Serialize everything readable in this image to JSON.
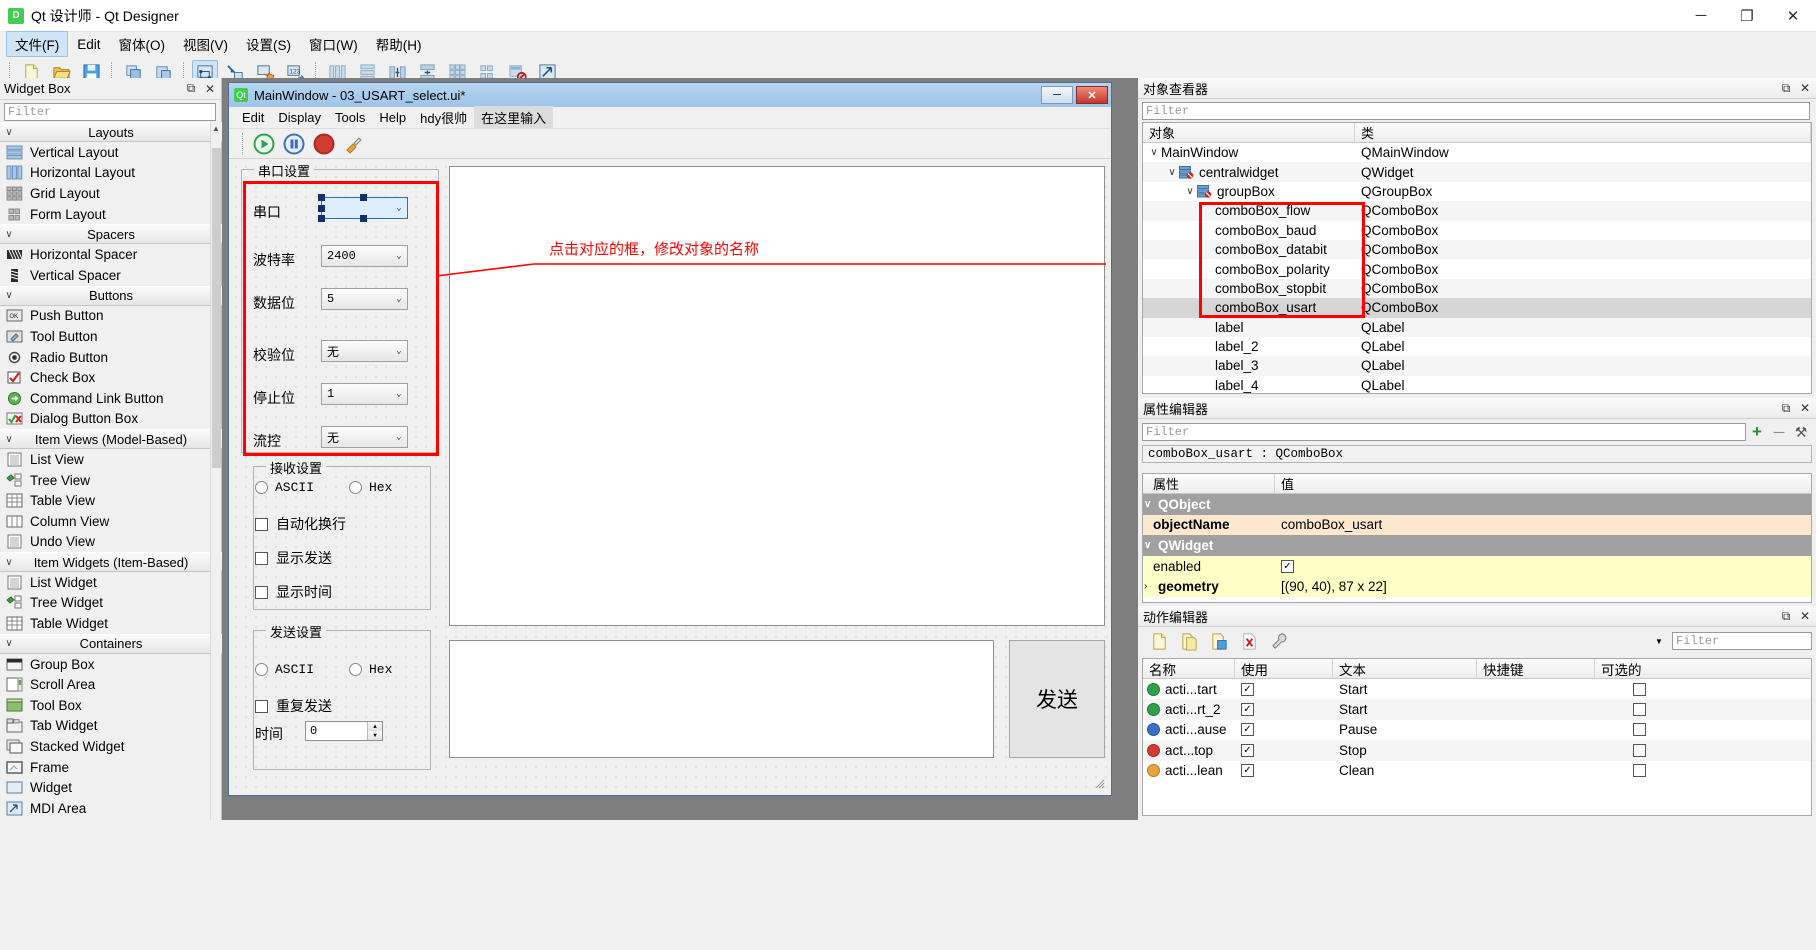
{
  "window": {
    "title": "Qt 设计师 - Qt Designer",
    "logo_text": "D",
    "minimize": "─",
    "maximize": "❐",
    "close": "✕"
  },
  "menubar": [
    {
      "label": "文件(F)",
      "active": true
    },
    {
      "label": "Edit",
      "active": false
    },
    {
      "label": "窗体(O)",
      "active": false
    },
    {
      "label": "视图(V)",
      "active": false
    },
    {
      "label": "设置(S)",
      "active": false
    },
    {
      "label": "窗口(W)",
      "active": false
    },
    {
      "label": "帮助(H)",
      "active": false
    }
  ],
  "toolbar": {
    "groups": [
      [
        "new-file-icon",
        "open-folder-icon",
        "save-icon"
      ],
      [
        "copy-icon",
        "paste-icon"
      ],
      [
        "edit-widgets-icon",
        "edit-signals-icon",
        "edit-buddies-icon",
        "edit-tab-order-icon"
      ],
      [
        "layout-horizontal-icon",
        "layout-vertical-icon",
        "layout-splitter-h-icon",
        "layout-splitter-v-icon",
        "layout-grid-icon",
        "layout-form-icon",
        "break-layout-icon",
        "adjust-size-icon"
      ]
    ]
  },
  "widget_box": {
    "title": "Widget Box",
    "filter_placeholder": "Filter",
    "float_btn": "⧉",
    "close_btn": "✕",
    "categories": [
      {
        "label": "Layouts",
        "items": [
          {
            "label": "Vertical Layout",
            "icon": "vertical-layout-icon"
          },
          {
            "label": "Horizontal Layout",
            "icon": "horizontal-layout-icon"
          },
          {
            "label": "Grid Layout",
            "icon": "grid-layout-icon"
          },
          {
            "label": "Form Layout",
            "icon": "form-layout-icon"
          }
        ]
      },
      {
        "label": "Spacers",
        "items": [
          {
            "label": "Horizontal Spacer",
            "icon": "horizontal-spacer-icon"
          },
          {
            "label": "Vertical Spacer",
            "icon": "vertical-spacer-icon"
          }
        ]
      },
      {
        "label": "Buttons",
        "items": [
          {
            "label": "Push Button",
            "icon": "push-button-icon"
          },
          {
            "label": "Tool Button",
            "icon": "tool-button-icon"
          },
          {
            "label": "Radio Button",
            "icon": "radio-button-icon"
          },
          {
            "label": "Check Box",
            "icon": "check-box-icon"
          },
          {
            "label": "Command Link Button",
            "icon": "command-link-icon"
          },
          {
            "label": "Dialog Button Box",
            "icon": "dialog-button-box-icon"
          }
        ]
      },
      {
        "label": "Item Views (Model-Based)",
        "items": [
          {
            "label": "List View",
            "icon": "list-view-icon"
          },
          {
            "label": "Tree View",
            "icon": "tree-view-icon"
          },
          {
            "label": "Table View",
            "icon": "table-view-icon"
          },
          {
            "label": "Column View",
            "icon": "column-view-icon"
          },
          {
            "label": "Undo View",
            "icon": "undo-view-icon"
          }
        ]
      },
      {
        "label": "Item Widgets (Item-Based)",
        "items": [
          {
            "label": "List Widget",
            "icon": "list-widget-icon"
          },
          {
            "label": "Tree Widget",
            "icon": "tree-widget-icon"
          },
          {
            "label": "Table Widget",
            "icon": "table-widget-icon"
          }
        ]
      },
      {
        "label": "Containers",
        "items": [
          {
            "label": "Group Box",
            "icon": "group-box-icon"
          },
          {
            "label": "Scroll Area",
            "icon": "scroll-area-icon"
          },
          {
            "label": "Tool Box",
            "icon": "tool-box-icon"
          },
          {
            "label": "Tab Widget",
            "icon": "tab-widget-icon"
          },
          {
            "label": "Stacked Widget",
            "icon": "stacked-widget-icon"
          },
          {
            "label": "Frame",
            "icon": "frame-icon"
          },
          {
            "label": "Widget",
            "icon": "widget-icon"
          },
          {
            "label": "MDI Area",
            "icon": "mdi-area-icon"
          }
        ]
      }
    ]
  },
  "form": {
    "title": "MainWindow - 03_USART_select.ui*",
    "logo_text": "Qt",
    "min_btn": "─",
    "close_btn": "✕",
    "menus": [
      {
        "label": "Edit",
        "hint": false
      },
      {
        "label": "Display",
        "hint": false
      },
      {
        "label": "Tools",
        "hint": false
      },
      {
        "label": "Help",
        "hint": false
      },
      {
        "label": "hdy很帅",
        "hint": false
      },
      {
        "label": "在这里输入",
        "hint": true
      }
    ],
    "toolbar_icons": [
      "start-icon",
      "pause-icon",
      "stop-icon",
      "clean-icon"
    ],
    "serial_group": {
      "title": "串口设置",
      "rows": [
        {
          "label": "串口",
          "value": "",
          "selected": true
        },
        {
          "label": "波特率",
          "value": "2400",
          "selected": false
        },
        {
          "label": "数据位",
          "value": "5",
          "selected": false
        },
        {
          "label": "校验位",
          "value": "无",
          "selected": false
        },
        {
          "label": "停止位",
          "value": "1",
          "selected": false
        },
        {
          "label": "流控",
          "value": "无",
          "selected": false
        }
      ]
    },
    "receive_group": {
      "title": "接收设置",
      "radios": [
        {
          "label": "ASCII"
        },
        {
          "label": "Hex"
        }
      ],
      "checkboxes": [
        {
          "label": "自动化换行"
        },
        {
          "label": "显示发送"
        },
        {
          "label": "显示时间"
        }
      ]
    },
    "send_group": {
      "title": "发送设置",
      "radios": [
        {
          "label": "ASCII"
        },
        {
          "label": "Hex"
        }
      ],
      "checkbox": "重复发送",
      "time_label": "时间",
      "time_value": "0"
    },
    "send_button": "发送",
    "annotation": "点击对应的框，修改对象的名称"
  },
  "object_inspector": {
    "title": "对象查看器",
    "float_btn": "⧉",
    "close_btn": "✕",
    "filter_placeholder": "Filter",
    "columns": [
      "对象",
      "类"
    ],
    "rows": [
      {
        "name": "MainWindow",
        "class": "QMainWindow",
        "indent": 0,
        "expander": "∨",
        "icon": "",
        "highlighted": false,
        "alt": false
      },
      {
        "name": "centralwidget",
        "class": "QWidget",
        "indent": 1,
        "expander": "∨",
        "icon": "layout-icon",
        "highlighted": false,
        "alt": true
      },
      {
        "name": "groupBox",
        "class": "QGroupBox",
        "indent": 2,
        "expander": "∨",
        "icon": "layout-icon",
        "highlighted": false,
        "alt": false
      },
      {
        "name": "comboBox_flow",
        "class": "QComboBox",
        "indent": 3,
        "expander": "",
        "icon": "",
        "highlighted": false,
        "alt": true
      },
      {
        "name": "comboBox_baud",
        "class": "QComboBox",
        "indent": 3,
        "expander": "",
        "icon": "",
        "highlighted": false,
        "alt": false
      },
      {
        "name": "comboBox_databit",
        "class": "QComboBox",
        "indent": 3,
        "expander": "",
        "icon": "",
        "highlighted": false,
        "alt": true
      },
      {
        "name": "comboBox_polarity",
        "class": "QComboBox",
        "indent": 3,
        "expander": "",
        "icon": "",
        "highlighted": false,
        "alt": false
      },
      {
        "name": "comboBox_stopbit",
        "class": "QComboBox",
        "indent": 3,
        "expander": "",
        "icon": "",
        "highlighted": false,
        "alt": true
      },
      {
        "name": "comboBox_usart",
        "class": "QComboBox",
        "indent": 3,
        "expander": "",
        "icon": "",
        "highlighted": true,
        "alt": false
      },
      {
        "name": "label",
        "class": "QLabel",
        "indent": 3,
        "expander": "",
        "icon": "",
        "highlighted": false,
        "alt": true
      },
      {
        "name": "label_2",
        "class": "QLabel",
        "indent": 3,
        "expander": "",
        "icon": "",
        "highlighted": false,
        "alt": false
      },
      {
        "name": "label_3",
        "class": "QLabel",
        "indent": 3,
        "expander": "",
        "icon": "",
        "highlighted": false,
        "alt": true
      },
      {
        "name": "label_4",
        "class": "QLabel",
        "indent": 3,
        "expander": "",
        "icon": "",
        "highlighted": false,
        "alt": false
      }
    ]
  },
  "property_editor": {
    "title": "属性编辑器",
    "float_btn": "⧉",
    "close_btn": "✕",
    "filter_placeholder": "Filter",
    "add_btn": "+",
    "remove_btn": "─",
    "config_btn": "⚒",
    "object_header": "comboBox_usart : QComboBox",
    "columns": [
      "属性",
      "值"
    ],
    "rows": [
      {
        "name": "QObject",
        "value": "",
        "type": "group",
        "expander": "∨"
      },
      {
        "name": "objectName",
        "value": "comboBox_usart",
        "type": "peach",
        "expander": ""
      },
      {
        "name": "QWidget",
        "value": "",
        "type": "group",
        "expander": "∨"
      },
      {
        "name": "enabled",
        "value": "",
        "type": "yellow-check",
        "expander": ""
      },
      {
        "name": "geometry",
        "value": "[(90, 40), 87 x 22]",
        "type": "yellow-bold",
        "expander": "›"
      }
    ]
  },
  "action_editor": {
    "title": "动作编辑器",
    "float_btn": "⧉",
    "close_btn": "✕",
    "filter_placeholder": "Filter",
    "toolbar_icons": [
      "new-action-icon",
      "copy-action-icon",
      "paste-action-icon",
      "delete-action-icon",
      "configure-icon"
    ],
    "columns": [
      "名称",
      "使用",
      "文本",
      "快捷键",
      "可选的"
    ],
    "rows": [
      {
        "icon_color": "#2fa14d",
        "name": "acti...tart",
        "used": true,
        "text": "Start",
        "shortcut": "",
        "checkable": false,
        "alt": false
      },
      {
        "icon_color": "#2fa14d",
        "name": "acti...rt_2",
        "used": true,
        "text": "Start",
        "shortcut": "",
        "checkable": false,
        "alt": true
      },
      {
        "icon_color": "#3a6fc4",
        "name": "acti...ause",
        "used": true,
        "text": "Pause",
        "shortcut": "",
        "checkable": false,
        "alt": false
      },
      {
        "icon_color": "#d23b32",
        "name": "act...top",
        "used": true,
        "text": "Stop",
        "shortcut": "",
        "checkable": false,
        "alt": true
      },
      {
        "icon_color": "#e8a33d",
        "name": "acti...lean",
        "used": true,
        "text": "Clean",
        "shortcut": "",
        "checkable": false,
        "alt": false
      }
    ]
  }
}
